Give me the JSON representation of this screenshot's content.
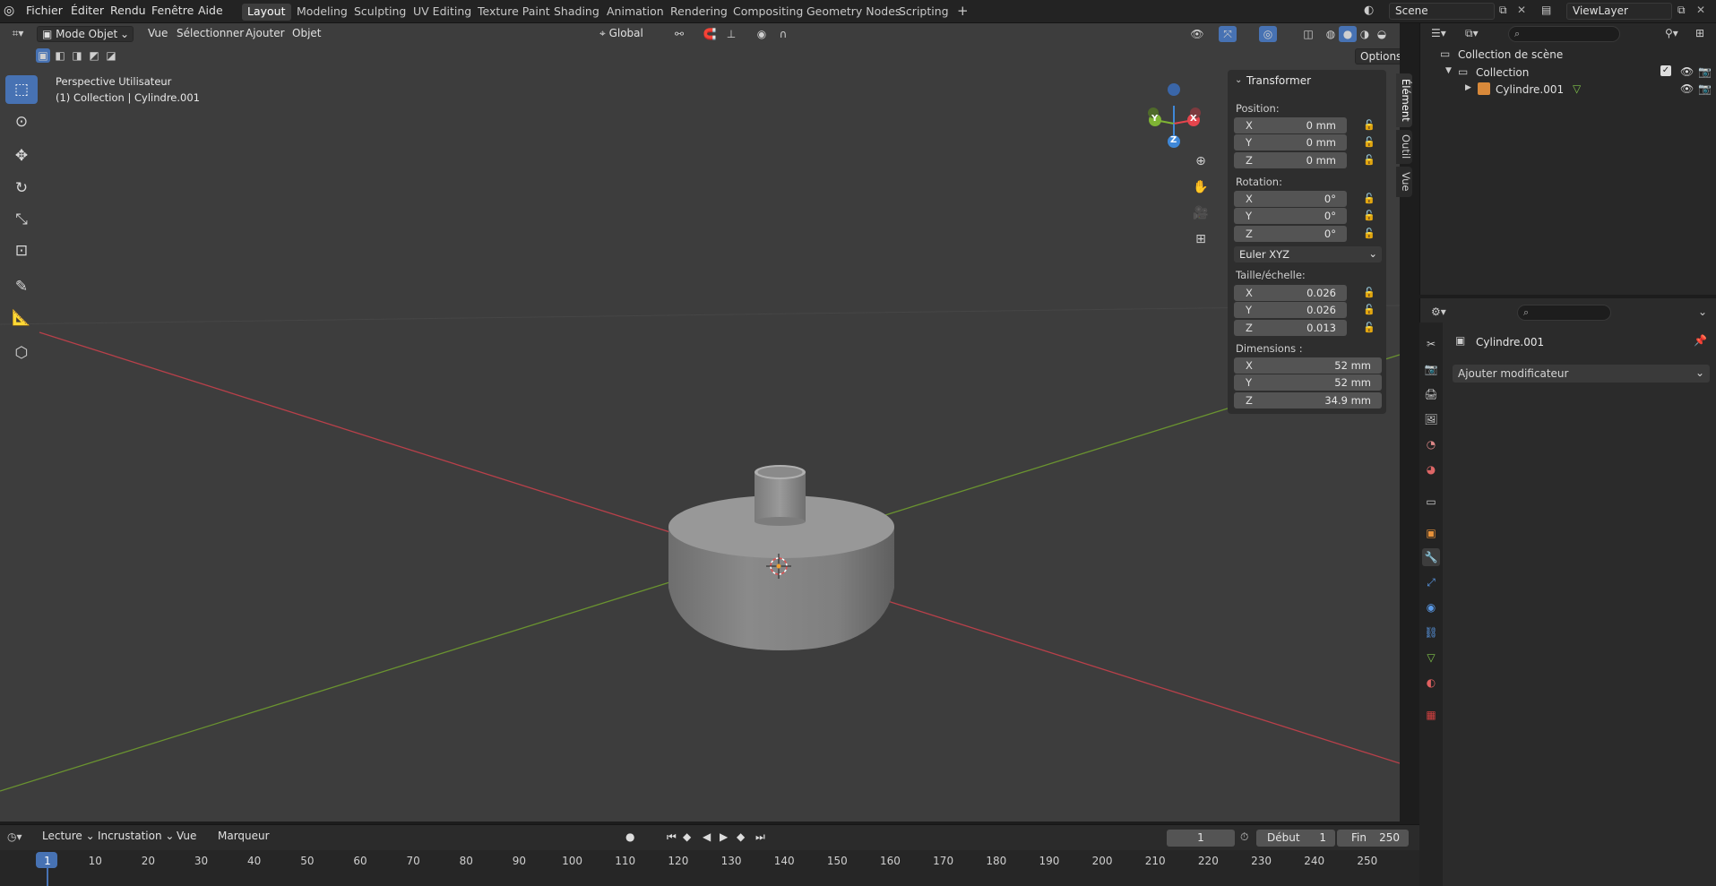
{
  "menus": [
    "Fichier",
    "Éditer",
    "Rendu",
    "Fenêtre",
    "Aide"
  ],
  "workspaces": [
    {
      "label": "Layout",
      "active": true
    },
    {
      "label": "Modeling"
    },
    {
      "label": "Sculpting"
    },
    {
      "label": "UV Editing"
    },
    {
      "label": "Texture Paint"
    },
    {
      "label": "Shading"
    },
    {
      "label": "Animation"
    },
    {
      "label": "Rendering"
    },
    {
      "label": "Compositing"
    },
    {
      "label": "Geometry Nodes"
    },
    {
      "label": "Scripting"
    }
  ],
  "add_workspace": "+",
  "scene": "Scene",
  "view_layer": "ViewLayer",
  "viewport_header": {
    "mode": "Mode Objet",
    "menu": [
      "Vue",
      "Sélectionner",
      "Ajouter",
      "Objet"
    ],
    "orientation": "Global",
    "options": "Options"
  },
  "viewport_info": {
    "line1": "Perspective Utilisateur",
    "line2": "(1) Collection | Cylindre.001"
  },
  "gizmo_axes": {
    "x": "X",
    "y": "Y",
    "z": "Z"
  },
  "transform_panel": {
    "title": "Transformer",
    "position_label": "Position:",
    "position": [
      {
        "axis": "X",
        "value": "0 mm"
      },
      {
        "axis": "Y",
        "value": "0 mm"
      },
      {
        "axis": "Z",
        "value": "0 mm"
      }
    ],
    "rotation_label": "Rotation:",
    "rotation": [
      {
        "axis": "X",
        "value": "0°"
      },
      {
        "axis": "Y",
        "value": "0°"
      },
      {
        "axis": "Z",
        "value": "0°"
      }
    ],
    "rotation_mode": "Euler XYZ",
    "scale_label": "Taille/échelle:",
    "scale": [
      {
        "axis": "X",
        "value": "0.026"
      },
      {
        "axis": "Y",
        "value": "0.026"
      },
      {
        "axis": "Z",
        "value": "0.013"
      }
    ],
    "dimensions_label": "Dimensions :",
    "dimensions": [
      {
        "axis": "X",
        "value": "52 mm"
      },
      {
        "axis": "Y",
        "value": "52 mm"
      },
      {
        "axis": "Z",
        "value": "34.9 mm"
      }
    ]
  },
  "sidebar_tabs": [
    "Élément",
    "Outil",
    "Vue"
  ],
  "outliner": {
    "scene_collection": "Collection de scène",
    "collection": "Collection",
    "object": "Cylindre.001"
  },
  "properties": {
    "object_name": "Cylindre.001",
    "add_modifier": "Ajouter modificateur"
  },
  "timeline": {
    "menu": [
      "Lecture",
      "Incrustation",
      "Vue",
      "Marqueur"
    ],
    "current_frame": "1",
    "start_label": "Début",
    "start": "1",
    "end_label": "Fin",
    "end": "250",
    "ruler": [
      "1",
      "10",
      "20",
      "30",
      "40",
      "50",
      "60",
      "70",
      "80",
      "90",
      "100",
      "110",
      "120",
      "130",
      "140",
      "150",
      "160",
      "170",
      "180",
      "190",
      "200",
      "210",
      "220",
      "230",
      "240",
      "250"
    ]
  },
  "colors": {
    "accent": "#4772b3",
    "x_axis": "#e5454d",
    "y_axis": "#7fb434",
    "z_axis": "#3f88d8",
    "viewport_bg": "#3d3d3d"
  }
}
